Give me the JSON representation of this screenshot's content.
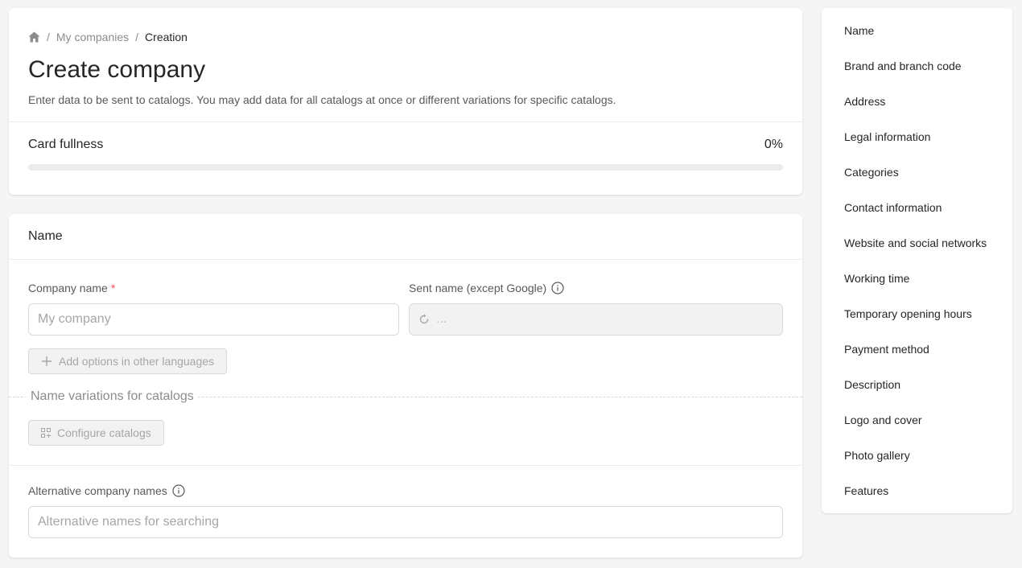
{
  "breadcrumb": {
    "home_icon": "home-icon",
    "separator": "/",
    "items": [
      "My companies",
      "Creation"
    ]
  },
  "header": {
    "title": "Create company",
    "subtitle": "Enter data to be sent to catalogs. You may add data for all catalogs at once or different variations for specific catalogs."
  },
  "fullness": {
    "label": "Card fullness",
    "value_text": "0%",
    "progress": 0
  },
  "name_section": {
    "title": "Name",
    "company_name": {
      "label": "Company name",
      "required_mark": "*",
      "placeholder": "My company",
      "value": ""
    },
    "sent_name": {
      "label": "Sent name (except Google)",
      "info_icon": "info-icon",
      "value": "..."
    },
    "add_languages_button": "Add options in other languages",
    "variations_title": "Name variations for catalogs",
    "configure_catalogs_button": "Configure catalogs",
    "alternative_names": {
      "label": "Alternative company names",
      "info_icon": "info-icon",
      "placeholder": "Alternative names for searching",
      "value": ""
    }
  },
  "nav": {
    "items": [
      "Name",
      "Brand and branch code",
      "Address",
      "Legal information",
      "Categories",
      "Contact information",
      "Website and social networks",
      "Working time",
      "Temporary opening hours",
      "Payment method",
      "Description",
      "Logo and cover",
      "Photo gallery",
      "Features"
    ]
  },
  "colors": {
    "background": "#f5f5f5",
    "card": "#ffffff",
    "required": "#ff4d4f",
    "progress_track": "#ececec",
    "disabled_bg": "#f2f2f2"
  }
}
